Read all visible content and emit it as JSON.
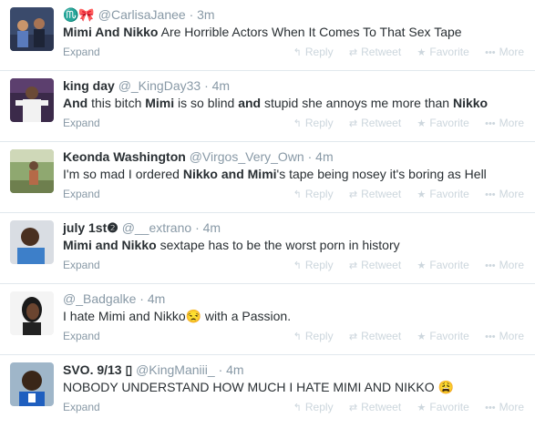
{
  "actions": {
    "reply": "Reply",
    "retweet": "Retweet",
    "favorite": "Favorite",
    "more": "More",
    "expand": "Expand"
  },
  "tweets": [
    {
      "name": "♏🎀",
      "handle": "@CarlisaJanee",
      "time": "· 3m",
      "segments": [
        {
          "text": "Mimi And Nikko",
          "bold": true
        },
        {
          "text": " Are Horrible Actors When It Comes To That Sex Tape",
          "bold": false
        }
      ]
    },
    {
      "name": "king day",
      "handle": "@_KingDay33",
      "time": "· 4m",
      "segments": [
        {
          "text": "And",
          "bold": true
        },
        {
          "text": " this bitch ",
          "bold": false
        },
        {
          "text": "Mimi",
          "bold": true
        },
        {
          "text": " is so blind ",
          "bold": false
        },
        {
          "text": "and",
          "bold": true
        },
        {
          "text": " stupid she annoys me more than ",
          "bold": false
        },
        {
          "text": "Nikko",
          "bold": true
        }
      ]
    },
    {
      "name": "Keonda Washington",
      "handle": "@Virgos_Very_Own",
      "time": "· 4m",
      "segments": [
        {
          "text": "I'm so mad I ordered ",
          "bold": false
        },
        {
          "text": "Nikko and Mimi",
          "bold": true
        },
        {
          "text": "'s tape being nosey it's boring as Hell",
          "bold": false
        }
      ]
    },
    {
      "name": "july 1st❷",
      "handle": "@__extrano",
      "time": "· 4m",
      "segments": [
        {
          "text": "Mimi and Nikko",
          "bold": true
        },
        {
          "text": " sextape has to be the worst porn in history",
          "bold": false
        }
      ]
    },
    {
      "name": "",
      "handle": "@_Badgalke",
      "time": "· 4m",
      "segments": [
        {
          "text": "I hate Mimi and Nikko",
          "bold": false
        },
        {
          "text": "😒",
          "bold": false,
          "emoji": true
        },
        {
          "text": " with a Passion.",
          "bold": false
        }
      ]
    },
    {
      "name": "SVO. 9/13 ▯",
      "handle": "@KingManiii_",
      "time": "· 4m",
      "segments": [
        {
          "text": "NOBODY UNDERSTAND HOW MUCH I HATE MIMI AND NIKKO ",
          "bold": false
        },
        {
          "text": "😩",
          "bold": false,
          "emoji": true
        }
      ]
    }
  ]
}
